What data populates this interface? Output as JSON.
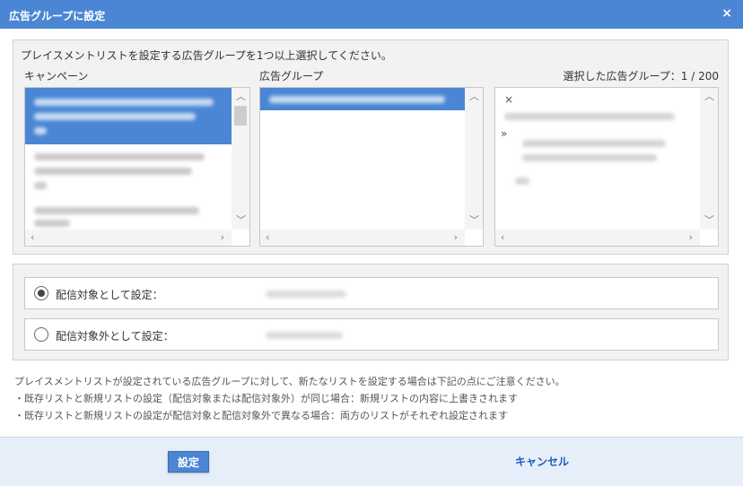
{
  "dialog": {
    "title": "広告グループに設定",
    "close_label": "×"
  },
  "selection": {
    "instruction": "プレイスメントリストを設定する広告グループを1つ以上選択してください。",
    "campaign_label": "キャンペーン",
    "adgroup_label": "広告グループ",
    "selected_counter": "選択した広告グループ：1 / 200",
    "selected_remove_mark": "×",
    "selected_expand_mark": "»"
  },
  "options": {
    "include_label": "配信対象として設定：",
    "exclude_label": "配信対象外として設定：",
    "selected": "include"
  },
  "notes": [
    "プレイスメントリストが設定されている広告グループに対して、新たなリストを設定する場合は下記の点にご注意ください。",
    "・既存リストと新規リストの設定（配信対象または配信対象外）が同じ場合：新規リストの内容に上書きされます",
    "・既存リストと新規リストの設定が配信対象と配信対象外で異なる場合：両方のリストがそれぞれ設定されます"
  ],
  "footer": {
    "set_label": "設定",
    "cancel_label": "キャンセル"
  },
  "icons": {
    "scroll_up": "chevron-up-icon",
    "scroll_down": "chevron-down-icon",
    "scroll_left": "chevron-left-icon",
    "scroll_right": "chevron-right-icon"
  },
  "colors": {
    "accent": "#4a86d4",
    "link": "#1a5fb4",
    "footer_bg": "#e5eef9"
  }
}
